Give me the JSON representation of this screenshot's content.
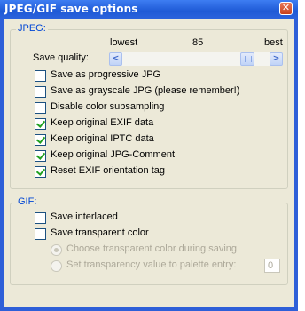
{
  "window": {
    "title": "JPEG/GIF save options",
    "close_glyph": "✕"
  },
  "jpeg": {
    "legend": "JPEG:",
    "scale": {
      "lowest": "lowest",
      "current": "85",
      "best": "best"
    },
    "save_quality_label": "Save quality:",
    "save_quality_value": 85,
    "checkboxes": [
      {
        "label": "Save as progressive JPG",
        "checked": false
      },
      {
        "label": "Save as grayscale JPG (please remember!)",
        "checked": false
      },
      {
        "label": "Disable color subsampling",
        "checked": false
      },
      {
        "label": "Keep original EXIF data",
        "checked": true
      },
      {
        "label": "Keep original IPTC data",
        "checked": true
      },
      {
        "label": "Keep original JPG-Comment",
        "checked": true
      },
      {
        "label": "Reset EXIF orientation tag",
        "checked": true
      }
    ]
  },
  "gif": {
    "legend": "GIF:",
    "checkboxes": [
      {
        "label": "Save interlaced",
        "checked": false
      },
      {
        "label": "Save transparent color",
        "checked": false
      }
    ],
    "radios": [
      {
        "label": "Choose transparent color during saving",
        "selected": true,
        "enabled": false
      },
      {
        "label": "Set transparency value to palette entry:",
        "selected": false,
        "enabled": false
      }
    ],
    "palette_entry_value": "0"
  },
  "colors": {
    "titlebar": "#2058d8",
    "legend": "#0046d5",
    "face": "#ece9d8"
  }
}
